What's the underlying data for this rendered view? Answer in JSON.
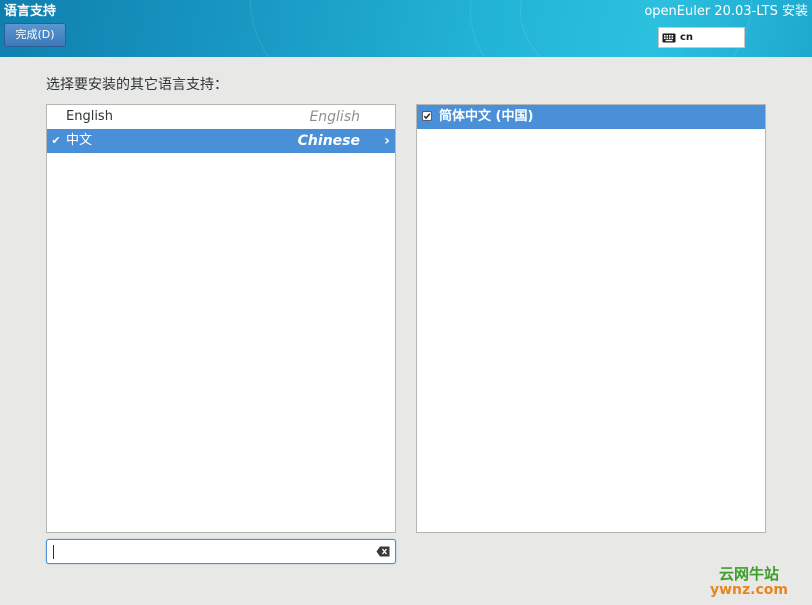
{
  "header": {
    "spoke_title": "语言支持",
    "done_button": "完成(D)",
    "product_title": "openEuler 20.03-LTS 安装",
    "keyboard_layout": "cn",
    "keyboard_icon": "keyboard-icon"
  },
  "main": {
    "instruction": "选择要安装的其它语言支持：",
    "languages": [
      {
        "native": "English",
        "english": "English",
        "checked": false,
        "selected": false
      },
      {
        "native": "中文",
        "english": "Chinese",
        "checked": true,
        "selected": true
      }
    ],
    "locales": [
      {
        "label": "简体中文 (中国)",
        "checked": true
      }
    ],
    "search": {
      "value": "",
      "placeholder": "",
      "clear_icon": "clear-icon"
    }
  },
  "colors": {
    "header_gradient_start": "#0f7fae",
    "header_gradient_end": "#2cc0df",
    "selection": "#4a90d9",
    "background": "#e8e8e7"
  },
  "watermark": {
    "line1": "云网牛站",
    "line2": "ywnz.com"
  }
}
